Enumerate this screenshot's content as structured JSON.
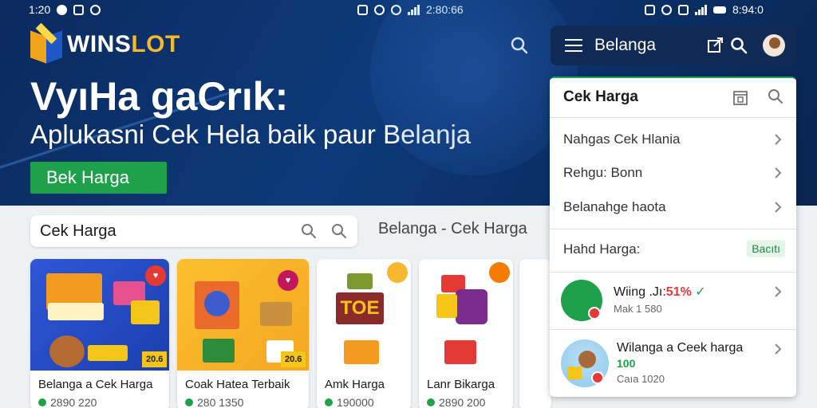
{
  "statusbar": {
    "time_left": "1:20",
    "time_mid": "2:80:66",
    "time_right": "8:94:0"
  },
  "brand": {
    "name_a": "WINS",
    "name_b": "LOT"
  },
  "hero": {
    "title": "VyıHa gaCrık:",
    "subtitle": "Aplukasni Cek Hela baik paur Belanja",
    "button_label": "Bek Harga"
  },
  "search": {
    "value": "Cek Harga"
  },
  "breadcrumb": "Belanga   - Cek Harga",
  "cards": [
    {
      "name": "Belanga a Cek Harga",
      "price": "2890 220",
      "tag": "20.6",
      "badge": "♥"
    },
    {
      "name": "Coak Hatea Terbaik",
      "price": "280 1350",
      "tag": "20.6",
      "badge": "♥"
    },
    {
      "name": "Amk Harga",
      "price": "190000",
      "label": "TOE"
    },
    {
      "name": "Lanr Bikarga",
      "price": "2890 200"
    }
  ],
  "appbar": {
    "title": "Belanga"
  },
  "panel": {
    "title": "Cek Harga",
    "rows": [
      {
        "label": "Nahgas Cek Hlania"
      },
      {
        "label": "Rehgu: Bonn"
      },
      {
        "label": "Belanahge haota"
      }
    ],
    "filter_row": {
      "label": "Hahd Harga:",
      "pill": "Bacıtı"
    },
    "items": [
      {
        "title_a": "Wiing .Jı:",
        "title_b": "51%",
        "subtitle": "Mak 1 580"
      },
      {
        "title": "Wilanga a Ceek harga",
        "highlight": "100",
        "subtitle": "Caıa 1020"
      }
    ]
  },
  "colors": {
    "accent_green": "#1fa04b",
    "brand_navy": "#0f2a55",
    "hero_blue": "#0d3a7a",
    "badge_red": "#e53935",
    "brand_yellow": "#f5b82e"
  }
}
